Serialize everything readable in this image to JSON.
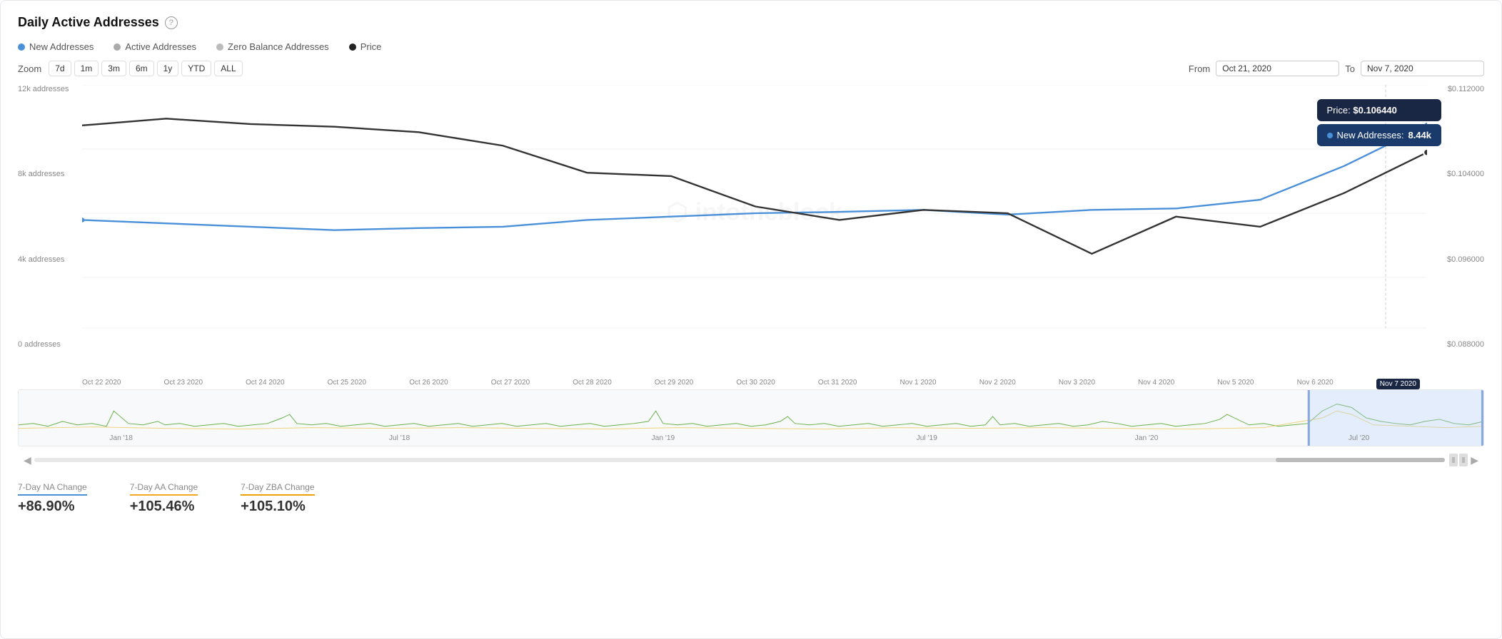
{
  "card": {
    "title": "Daily Active Addresses",
    "help_tooltip": "Help"
  },
  "legend": {
    "items": [
      {
        "id": "new-addresses",
        "label": "New Addresses",
        "color": "#4a90d9"
      },
      {
        "id": "active-addresses",
        "label": "Active Addresses",
        "color": "#aaa"
      },
      {
        "id": "zero-balance",
        "label": "Zero Balance Addresses",
        "color": "#bbb"
      },
      {
        "id": "price",
        "label": "Price",
        "color": "#222"
      }
    ]
  },
  "zoom": {
    "label": "Zoom",
    "buttons": [
      "7d",
      "1m",
      "3m",
      "6m",
      "1y",
      "YTD",
      "ALL"
    ]
  },
  "date_range": {
    "from_label": "From",
    "from_value": "Oct 21, 2020",
    "to_label": "To",
    "to_value": "Nov 7, 2020"
  },
  "y_axis_left": {
    "values": [
      "12k addresses",
      "8k addresses",
      "4k addresses",
      "0 addresses"
    ]
  },
  "y_axis_right": {
    "values": [
      "$0.112000",
      "$0.104000",
      "$0.096000",
      "$0.088000"
    ]
  },
  "x_axis": {
    "labels": [
      "Oct 22 2020",
      "Oct 23 2020",
      "Oct 24 2020",
      "Oct 25 2020",
      "Oct 26 2020",
      "Oct 27 2020",
      "Oct 28 2020",
      "Oct 29 2020",
      "Oct 30 2020",
      "Oct 31 2020",
      "Nov 1 2020",
      "Nov 2 2020",
      "Nov 3 2020",
      "Nov 4 2020",
      "Nov 5 2020",
      "Nov 6 2020",
      "Nov 7 2020"
    ],
    "highlighted": "Nov 7 2020"
  },
  "tooltip": {
    "price_label": "Price:",
    "price_value": "$0.106440",
    "new_addr_label": "New Addresses:",
    "new_addr_value": "8.44k"
  },
  "mini_chart": {
    "labels": [
      "Jan '18",
      "Jul '18",
      "Jan '19",
      "Jul '19",
      "Jan '20",
      "Jul '20"
    ]
  },
  "stats": [
    {
      "id": "7d-na",
      "label": "7-Day NA Change",
      "value": "+86.90%",
      "color_class": "blue"
    },
    {
      "id": "7d-aa",
      "label": "7-Day AA Change",
      "value": "+105.46%",
      "color_class": "gold"
    },
    {
      "id": "7d-zba",
      "label": "7-Day ZBA Change",
      "value": "+105.10%",
      "color_class": "orange"
    }
  ],
  "watermark": "intotheblock"
}
